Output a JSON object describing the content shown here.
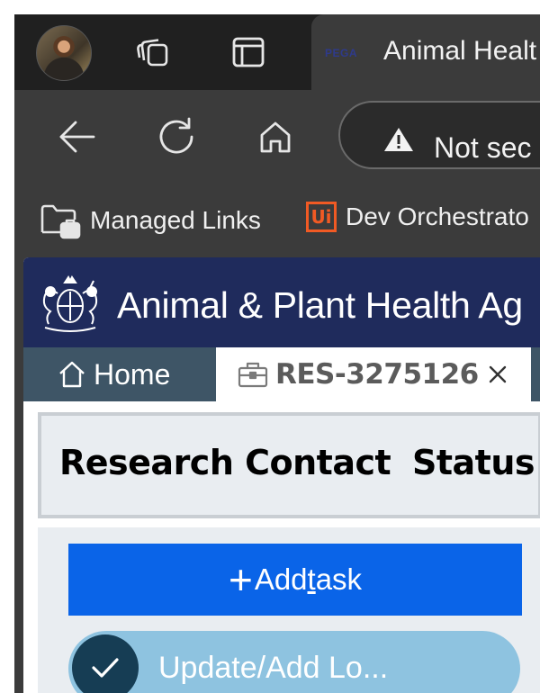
{
  "browser": {
    "tab": {
      "favicon_text": "PEGA",
      "title": "Animal Healt"
    },
    "address_bar": {
      "security_text": "Not sec"
    },
    "bookmarks": [
      {
        "label": "Managed Links",
        "icon": "folder-briefcase-icon"
      },
      {
        "label": "Dev Orchestrato",
        "icon": "uipath-logo-icon",
        "logo_text": "Ui"
      }
    ]
  },
  "app": {
    "header_title": "Animal & Plant Health Ag",
    "tabs": {
      "home_label": "Home",
      "case_label": "RES-3275126"
    },
    "case_header": {
      "case_type": "Research Contact",
      "status_label": "Status"
    },
    "tasks": {
      "add_label_before": "Add ",
      "add_label_mnemonic": "t",
      "add_label_after": "ask",
      "items": [
        {
          "label": "Update/Add Lo..."
        }
      ]
    }
  },
  "colors": {
    "header_bg": "#1f2b5c",
    "primary_button": "#0a64e8",
    "task_pill": "#8ec3e0",
    "home_tab": "#3e5566",
    "uipath_orange": "#f15a24"
  }
}
